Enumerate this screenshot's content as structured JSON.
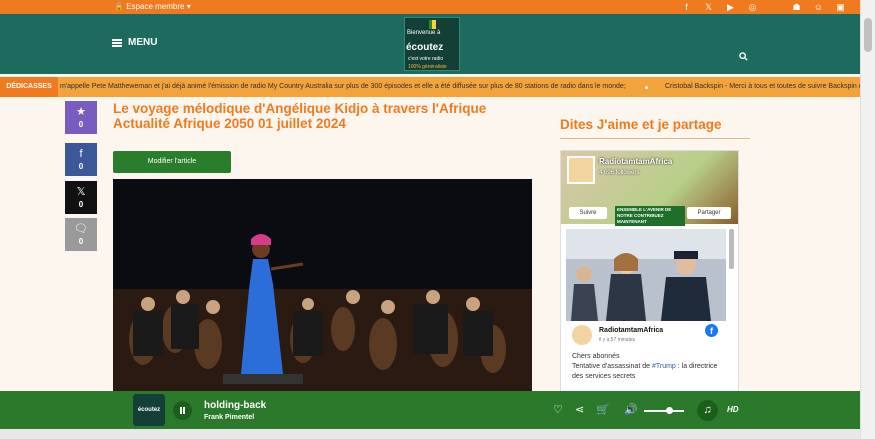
{
  "topbar": {
    "member_label": "Espace membre",
    "socials": [
      "facebook-icon",
      "x-icon",
      "youtube-icon",
      "instagram-icon",
      "apple-icon",
      "android-icon",
      "snapchat-icon",
      "app-icon"
    ],
    "colors": {
      "topbar": "#f07a1f",
      "header": "#1c6b5e"
    }
  },
  "header": {
    "menu_label": "MENU",
    "logo": {
      "line1": "Bienvenue à",
      "line2": "écoutez",
      "line3": "c'est votre radio",
      "line4": "100% généraliste"
    }
  },
  "ticker": {
    "label": "DÉDICASSES",
    "messages": [
      "m'appelle Pete Mattheweman et j'ai déjà animé l'émission de radio My Country Australia sur plus de 300 épisodes et elle a été diffusée sur plus de 80 stations de radio dans le monde;",
      "Cristobal Backspin - Merci à tous et toutes de suivre Backspin d"
    ]
  },
  "share": [
    {
      "icon": "star-icon",
      "count": "0",
      "color": "#7a5cc1"
    },
    {
      "icon": "facebook-icon",
      "count": "0",
      "color": "#3b5998"
    },
    {
      "icon": "x-icon",
      "count": "0",
      "color": "#111111"
    },
    {
      "icon": "comment-icon",
      "count": "0",
      "color": "#9a9a9a"
    }
  ],
  "article": {
    "title": "Le voyage mélodique d'Angélique Kidjo à travers l'Afrique Actualité Afrique 2050 01 juillet 2024",
    "edit_label": "Modifier l'article"
  },
  "sidebar": {
    "title": "Dites J'aime et je partage",
    "fb": {
      "page_name": "RadiotamtamAfrica",
      "followers": "4 096 followers",
      "follow_label": "Suivre",
      "share_label": "Partager",
      "banner": "ENSEMBLE L'AVENIR DE NOTRE CONTRIBUEZ MAINTENANT",
      "post_author": "RadiotamtamAfrica",
      "post_time": "il y a 57 minutes",
      "post_line1": "Chers abonnés",
      "post_text_a": "Tentative d'assassinat de ",
      "post_hashtag": "#Trump",
      "post_text_b": " : la directrice des services secrets"
    }
  },
  "player": {
    "track": "holding-back",
    "artist": "Frank Pimentel",
    "quality": "HD",
    "volume_fraction": 0.6
  }
}
